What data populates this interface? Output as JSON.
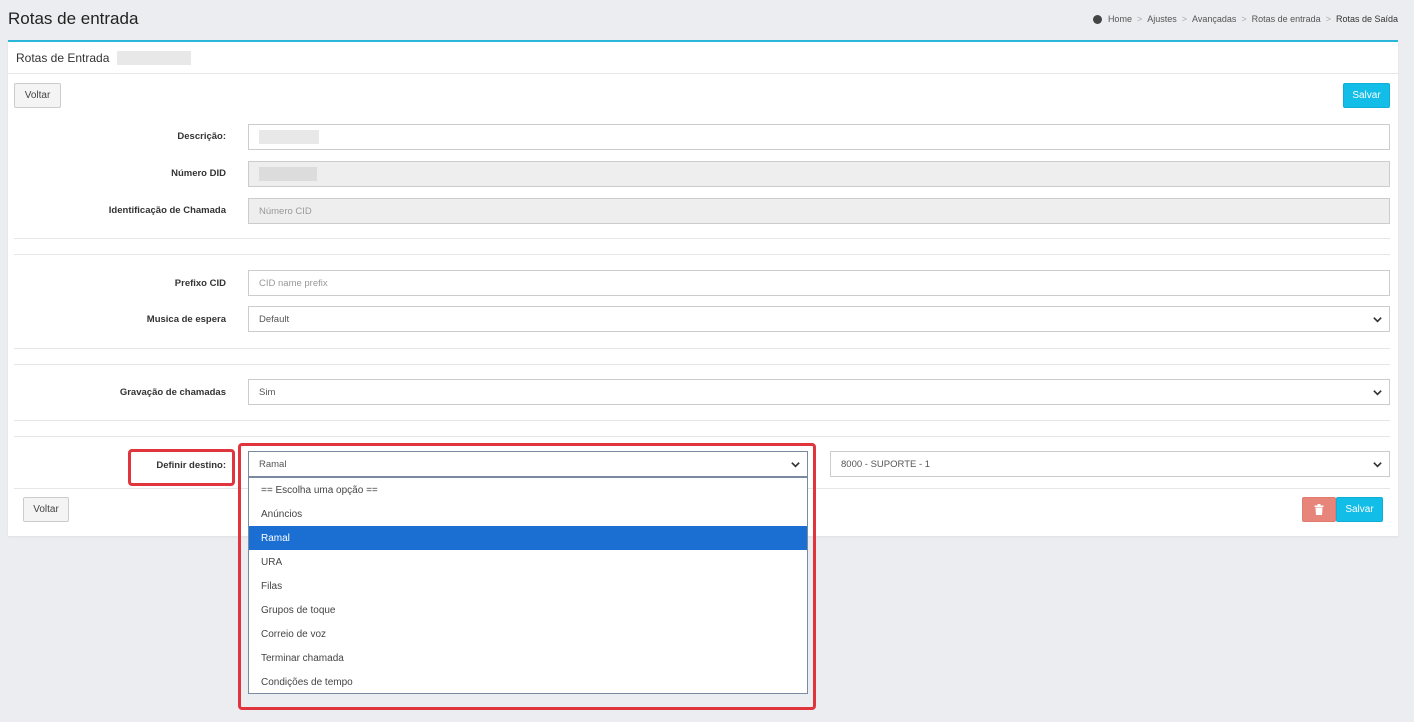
{
  "header": {
    "title": "Rotas de entrada",
    "breadcrumb": [
      "Home",
      "Ajustes",
      "Avançadas",
      "Rotas de entrada",
      "Rotas de Saída"
    ]
  },
  "panel": {
    "title": "Rotas de Entrada",
    "back_label": "Voltar",
    "save_label": "Salvar"
  },
  "form": {
    "descricao_label": "Descrição:",
    "descricao_value": "",
    "did_label": "Número DID",
    "did_value": "",
    "cid_label": "Identificação de Chamada",
    "cid_placeholder": "Número CID",
    "prefixo_label": "Prefixo CID",
    "prefixo_placeholder": "CID name prefix",
    "musica_label": "Musica de espera",
    "musica_value": "Default",
    "gravacao_label": "Gravação de chamadas",
    "gravacao_value": "Sim",
    "destino_label": "Definir destino:",
    "destino_value": "Ramal",
    "destino_target_value": "8000 - SUPORTE - 1"
  },
  "dropdown": {
    "options": [
      "== Escolha uma opção ==",
      "Anúncios",
      "Ramal",
      "URA",
      "Filas",
      "Grupos de toque",
      "Correio de voz",
      "Terminar chamada",
      "Condições de tempo"
    ],
    "selected": "Ramal"
  },
  "footer": {
    "back_label": "Voltar",
    "save_label": "Salvar",
    "delete_icon": "trash-icon"
  },
  "colors": {
    "accent": "#12bde8",
    "danger": "#e8857a",
    "highlight": "#e0353d",
    "selected_option": "#1c6fd2"
  }
}
